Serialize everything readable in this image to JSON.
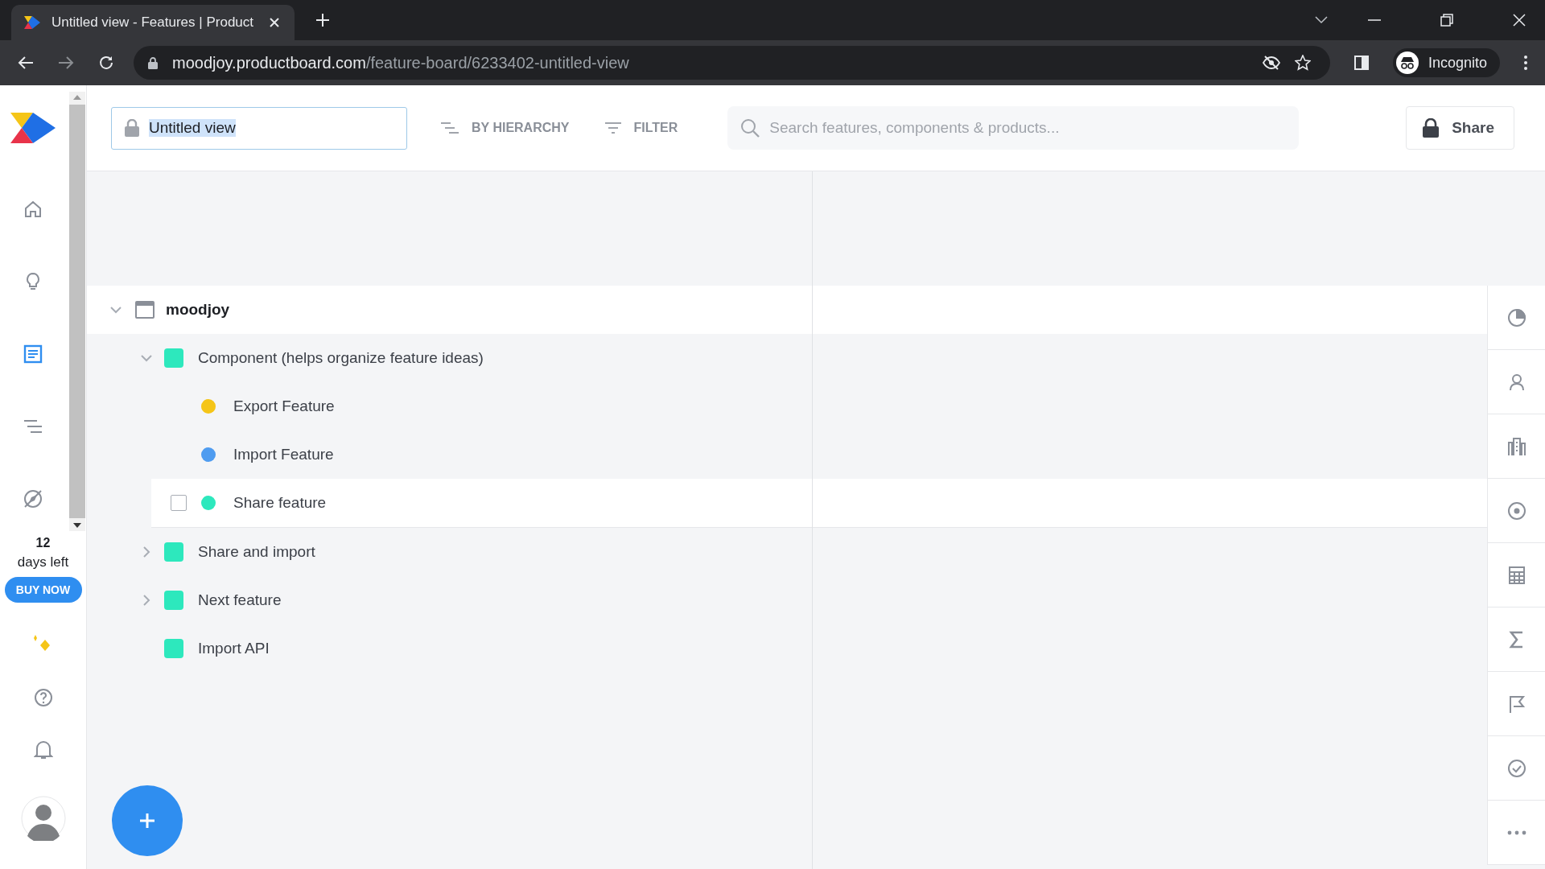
{
  "browser": {
    "tab_title": "Untitled view - Features | Product",
    "url_host": "moodjoy.productboard.com",
    "url_path": "/feature-board/6233402-untitled-view",
    "profile": "Incognito"
  },
  "sidebar": {
    "nav_items": [
      {
        "selected": false
      },
      {
        "selected": false
      },
      {
        "selected": true
      },
      {
        "selected": false
      },
      {
        "selected": false
      }
    ],
    "trial_days": "12",
    "trial_label": "days left",
    "buy_button": "BUY NOW"
  },
  "header": {
    "view_name": "Untitled view",
    "group_by": "BY HIERARCHY",
    "filter": "FILTER",
    "search_placeholder": "Search features, components & products...",
    "share": "Share"
  },
  "tree": {
    "name": "moodjoy",
    "expanded": true,
    "children": [
      {
        "name": "Component (helps organize feature ideas)",
        "color": "#2de8bd",
        "expanded": true,
        "children": [
          {
            "name": "Export Feature",
            "color": "#f5c518",
            "highlighted": false
          },
          {
            "name": "Import Feature",
            "color": "#4f9cf0",
            "highlighted": false
          },
          {
            "name": "Share feature",
            "color": "#2de8bd",
            "highlighted": true
          }
        ]
      },
      {
        "name": "Share and import",
        "color": "#2de8bd",
        "expanded": false
      },
      {
        "name": "Next feature",
        "color": "#2de8bd",
        "expanded": false
      },
      {
        "name": "Import API",
        "color": "#2de8bd"
      }
    ]
  }
}
